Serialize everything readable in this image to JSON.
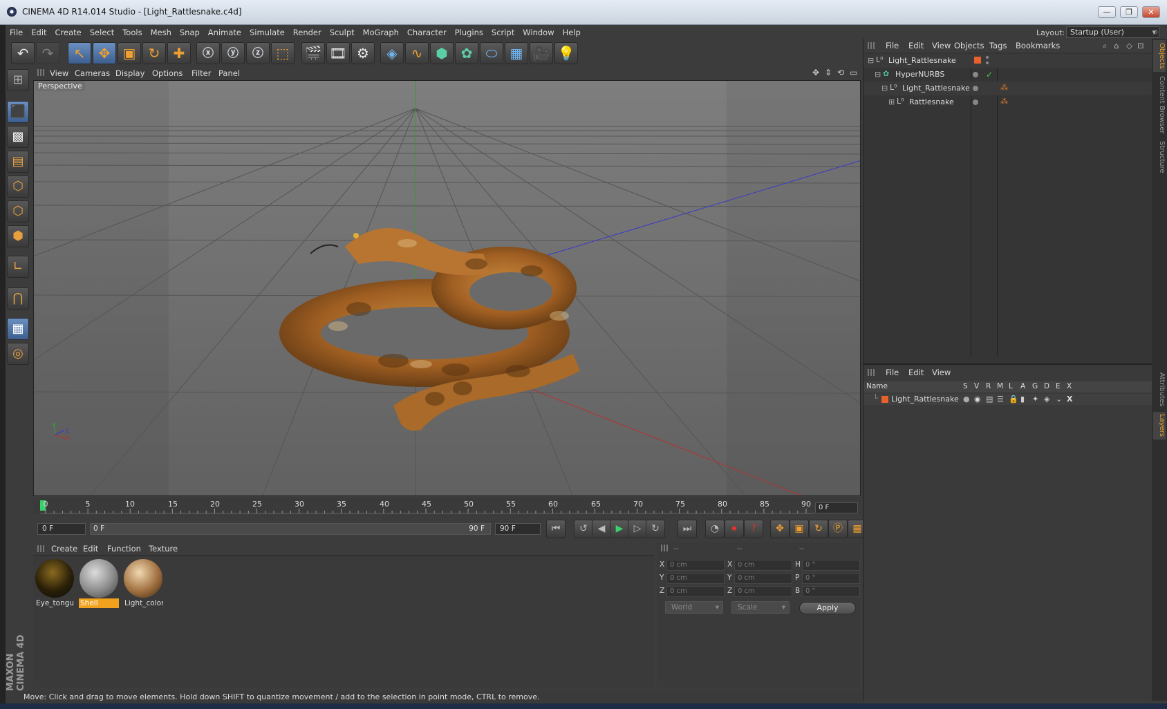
{
  "window": {
    "title": "CINEMA 4D R14.014 Studio - [Light_Rattlesnake.c4d]",
    "minimize": "—",
    "restore": "❐",
    "close": "✕"
  },
  "menubar": {
    "items": [
      "File",
      "Edit",
      "Create",
      "Select",
      "Tools",
      "Mesh",
      "Snap",
      "Animate",
      "Simulate",
      "Render",
      "Sculpt",
      "MoGraph",
      "Character",
      "Plugins",
      "Script",
      "Window",
      "Help"
    ],
    "layout_label": "Layout:",
    "layout_value": "Startup (User)"
  },
  "viewport": {
    "menus": [
      "View",
      "Cameras",
      "Display",
      "Options",
      "Filter",
      "Panel"
    ],
    "label": "Perspective",
    "axis_y": "Y",
    "axis_x": "X",
    "axis_z": "Z"
  },
  "timeline": {
    "ticks": [
      "0",
      "5",
      "10",
      "15",
      "20",
      "25",
      "30",
      "35",
      "40",
      "45",
      "50",
      "55",
      "60",
      "65",
      "70",
      "75",
      "80",
      "85",
      "90"
    ],
    "end_frame": "0 F"
  },
  "transport": {
    "current_frame": "0 F",
    "range_start": "0 F",
    "range_end_inner": "90 F",
    "range_end": "90 F"
  },
  "materials": {
    "menus": [
      "Create",
      "Edit",
      "Function",
      "Texture"
    ],
    "items": [
      {
        "label": "Eye_tongu",
        "selected": false
      },
      {
        "label": "Shell",
        "selected": true
      },
      {
        "label": "Light_color",
        "selected": false
      }
    ]
  },
  "coordinates": {
    "headers": [
      "--",
      "--",
      "--"
    ],
    "rows": [
      {
        "l1": "X",
        "v1": "0 cm",
        "l2": "X",
        "v2": "0 cm",
        "l3": "H",
        "v3": "0 °"
      },
      {
        "l1": "Y",
        "v1": "0 cm",
        "l2": "Y",
        "v2": "0 cm",
        "l3": "P",
        "v3": "0 °"
      },
      {
        "l1": "Z",
        "v1": "0 cm",
        "l2": "Z",
        "v2": "0 cm",
        "l3": "B",
        "v3": "0 °"
      }
    ],
    "world": "World",
    "scale": "Scale",
    "apply": "Apply"
  },
  "objects_panel": {
    "menus": [
      "File",
      "Edit",
      "View",
      "Objects",
      "Tags",
      "Bookmarks"
    ],
    "tree": [
      "Light_Rattlesnake",
      "HyperNURBS",
      "Light_Rattlesnake",
      "Rattlesnake"
    ]
  },
  "layers_panel": {
    "menus": [
      "File",
      "Edit",
      "View"
    ],
    "columns": [
      "Name",
      "S",
      "V",
      "R",
      "M",
      "L",
      "A",
      "G",
      "D",
      "E",
      "X"
    ],
    "row": "Light_Rattlesnake"
  },
  "side_tabs": [
    "Objects",
    "Content Browser",
    "Structure",
    "Attributes",
    "Layers"
  ],
  "branding": "MAXON CINEMA 4D",
  "status": "Move: Click and drag to move elements. Hold down SHIFT to quantize movement / add to the selection in point mode, CTRL to remove."
}
